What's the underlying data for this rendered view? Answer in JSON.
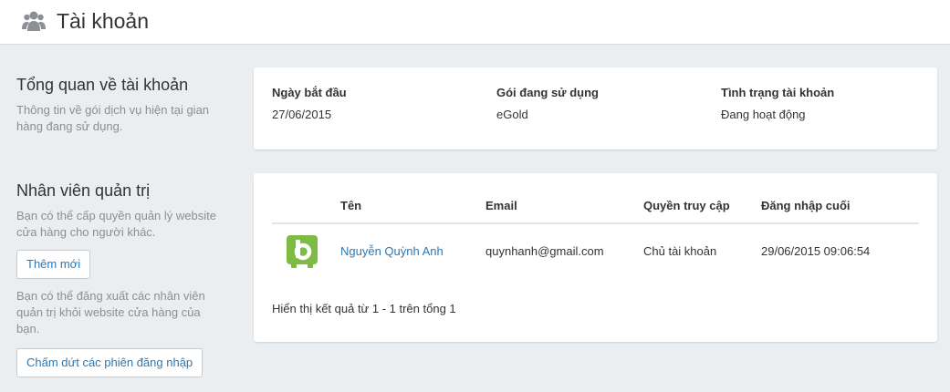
{
  "header": {
    "title": "Tài khoản",
    "icon": "users-icon"
  },
  "overview": {
    "title": "Tổng quan về tài khoản",
    "description": "Thông tin về gói dịch vụ hiện tại gian hàng đang sử dụng.",
    "columns": [
      {
        "label": "Ngày bắt đầu",
        "value": "27/06/2015"
      },
      {
        "label": "Gói đang sử dụng",
        "value": "eGold"
      },
      {
        "label": "Tình trạng tài khoản",
        "value": "Đang hoạt động"
      }
    ]
  },
  "staff": {
    "title": "Nhân viên quản trị",
    "description": "Bạn có thể cấp quyền quản lý website cửa hàng cho người khác.",
    "add_button": "Thêm mới",
    "logout_description": "Bạn có thể đăng xuất các nhân viên quản trị khỏi website cửa hàng của bạn.",
    "terminate_button": "Chấm dứt các phiên đăng nhập",
    "table": {
      "headers": [
        "Tên",
        "Email",
        "Quyền truy cập",
        "Đăng nhập cuối"
      ],
      "rows": [
        {
          "avatar_icon": "green-b-logo-icon",
          "name": "Nguyễn Quỳnh Anh",
          "email": "quynhanh@gmail.com",
          "role": "Chủ tài khoản",
          "last_login": "29/06/2015 09:06:54"
        }
      ]
    },
    "footer": "Hiển thị kết quả từ 1 - 1 trên tổng 1"
  },
  "colors": {
    "link": "#2a79b7",
    "avatar_green": "#7dbb42",
    "background": "#ebeef0"
  }
}
